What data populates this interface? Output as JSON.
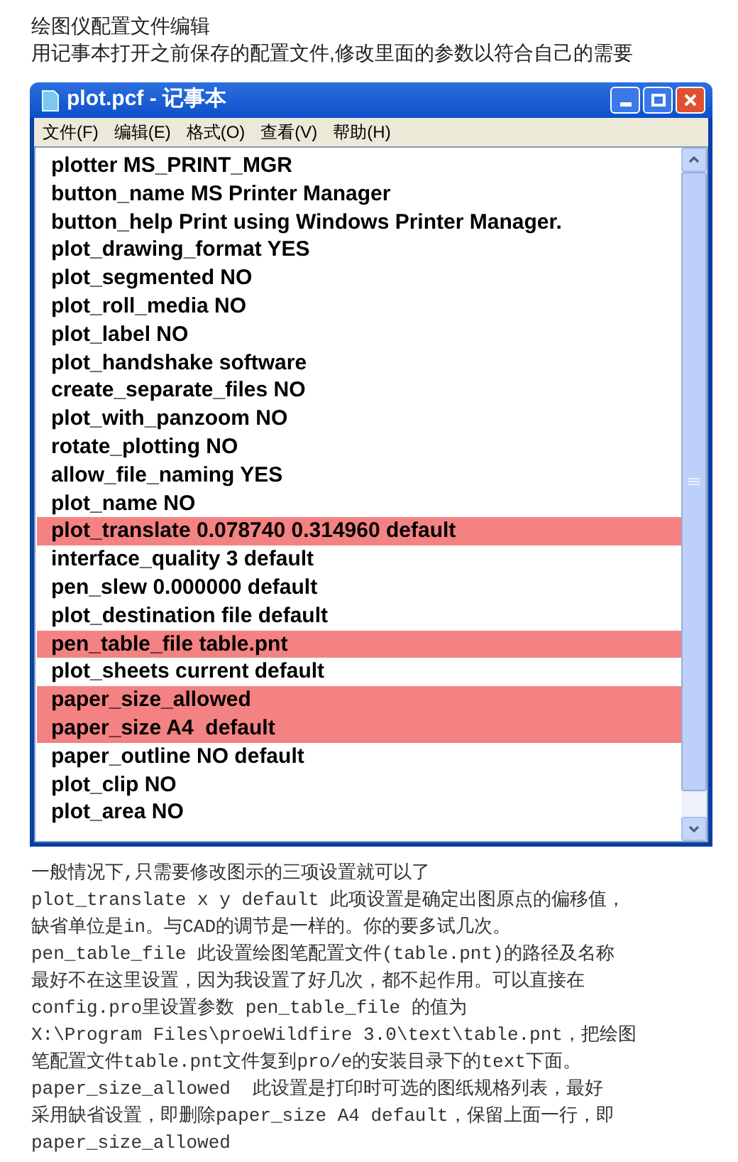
{
  "heading": [
    "绘图仪配置文件编辑",
    "用记事本打开之前保存的配置文件,修改里面的参数以符合自己的需要"
  ],
  "window": {
    "title": "plot.pcf - 记事本"
  },
  "menu": [
    "文件(F)",
    "编辑(E)",
    "格式(O)",
    "查看(V)",
    "帮助(H)"
  ],
  "lines": [
    {
      "text": "plotter MS_PRINT_MGR",
      "highlighted": false
    },
    {
      "text": "button_name MS Printer Manager",
      "highlighted": false
    },
    {
      "text": "button_help Print using Windows Printer Manager.",
      "highlighted": false
    },
    {
      "text": "plot_drawing_format YES",
      "highlighted": false
    },
    {
      "text": "plot_segmented NO",
      "highlighted": false
    },
    {
      "text": "plot_roll_media NO",
      "highlighted": false
    },
    {
      "text": "plot_label NO",
      "highlighted": false
    },
    {
      "text": "plot_handshake software",
      "highlighted": false
    },
    {
      "text": "create_separate_files NO",
      "highlighted": false
    },
    {
      "text": "plot_with_panzoom NO",
      "highlighted": false
    },
    {
      "text": "rotate_plotting NO",
      "highlighted": false
    },
    {
      "text": "allow_file_naming YES",
      "highlighted": false
    },
    {
      "text": "plot_name NO",
      "highlighted": false
    },
    {
      "text": "plot_translate 0.078740 0.314960 default",
      "highlighted": true
    },
    {
      "text": "interface_quality 3 default",
      "highlighted": false
    },
    {
      "text": "pen_slew 0.000000 default",
      "highlighted": false
    },
    {
      "text": "plot_destination file default",
      "highlighted": false
    },
    {
      "text": "pen_table_file table.pnt",
      "highlighted": true
    },
    {
      "text": "plot_sheets current default",
      "highlighted": false
    },
    {
      "text": "paper_size_allowed",
      "highlighted": true
    },
    {
      "text": "paper_size A4  default",
      "highlighted": true
    },
    {
      "text": "paper_outline NO default",
      "highlighted": false
    },
    {
      "text": "plot_clip NO",
      "highlighted": false
    },
    {
      "text": "plot_area NO",
      "highlighted": false
    }
  ],
  "notes": [
    "一般情况下,只需要修改图示的三项设置就可以了",
    "plot_translate x y default 此项设置是确定出图原点的偏移值，",
    "缺省单位是in。与CAD的调节是一样的。你的要多试几次。",
    "pen_table_file 此设置绘图笔配置文件(table.pnt)的路径及名称",
    "最好不在这里设置，因为我设置了好几次，都不起作用。可以直接在",
    "config.pro里设置参数 pen_table_file 的值为",
    "X:\\Program Files\\proeWildfire 3.0\\text\\table.pnt，把绘图",
    "笔配置文件table.pnt文件复到pro/e的安装目录下的text下面。",
    "paper_size_allowed  此设置是打印时可选的图纸规格列表，最好",
    "采用缺省设置，即删除paper_size A4 default，保留上面一行，即",
    "paper_size_allowed"
  ]
}
